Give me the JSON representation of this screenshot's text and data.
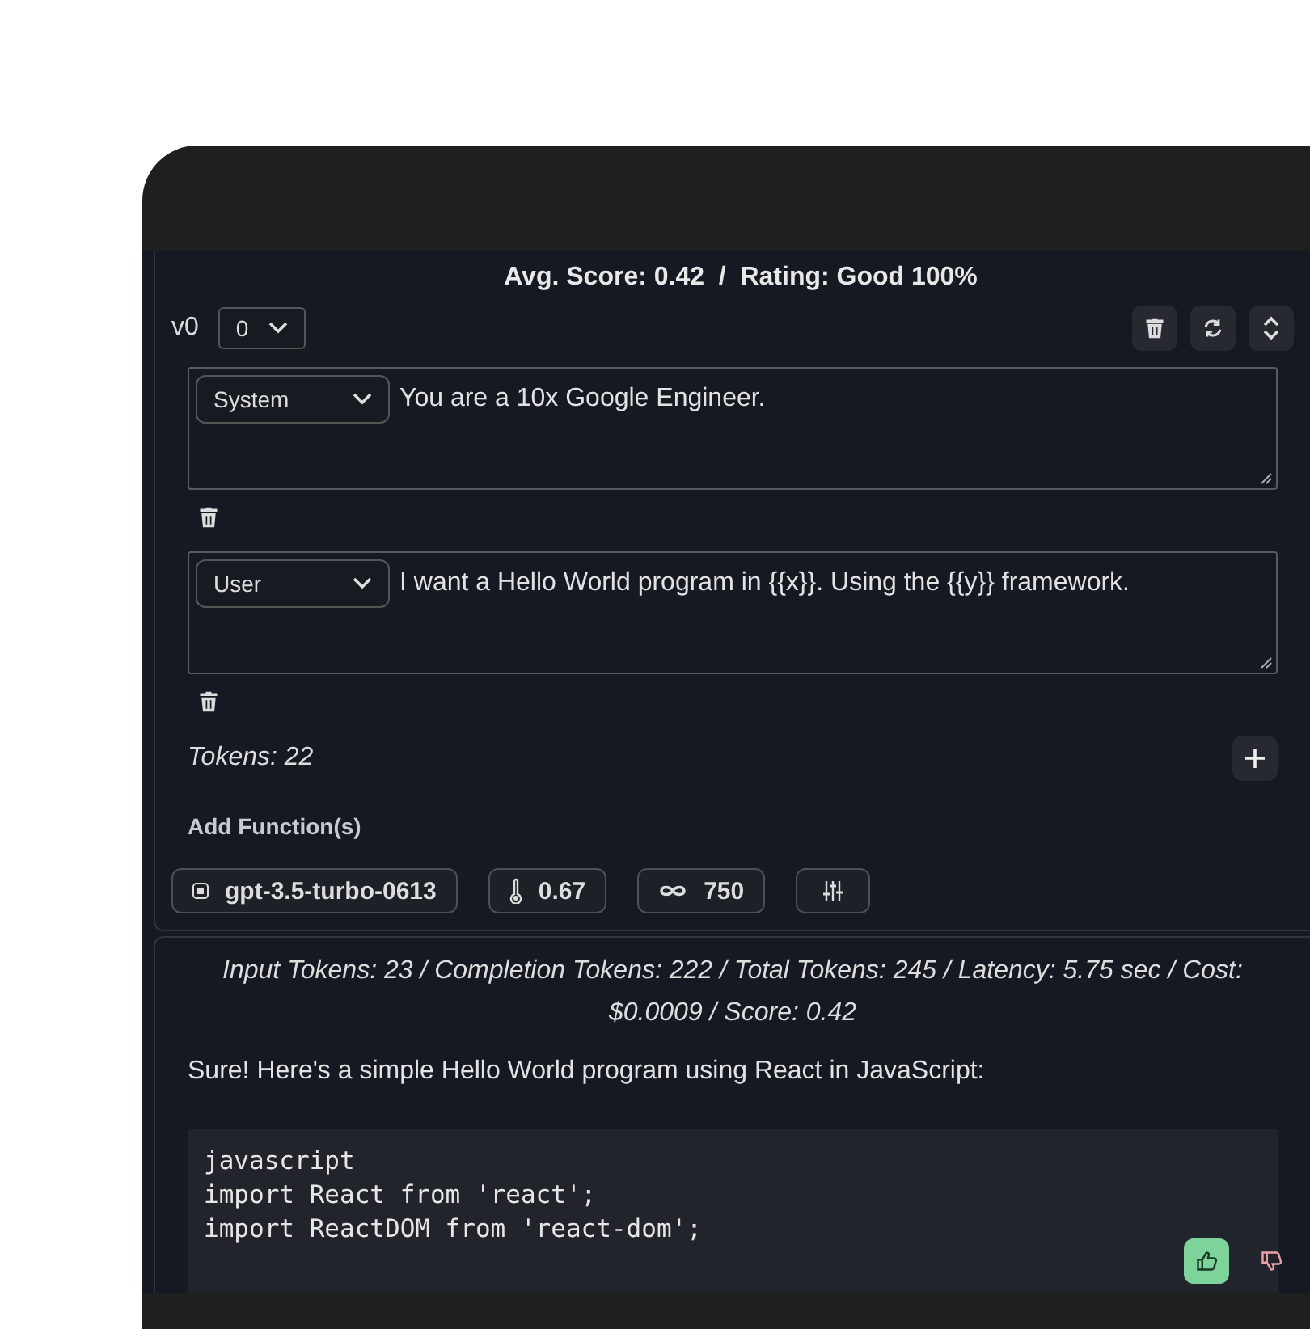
{
  "summary": "Avg. Score: 0.42  /  Rating: Good 100%",
  "version": {
    "label": "v0",
    "value": "0"
  },
  "toolbar": [
    {
      "kind": "delete"
    },
    {
      "kind": "refresh"
    },
    {
      "kind": "collapse"
    }
  ],
  "messages": [
    {
      "role": "System",
      "content": "You are a 10x Google Engineer."
    },
    {
      "role": "User",
      "content": "I want a Hello World program in {{x}}. Using the {{y}} framework."
    }
  ],
  "tokens": "Tokens: 22",
  "add_functions": "Add Function(s)",
  "settings": [
    {
      "kind": "model",
      "value": "gpt-3.5-turbo-0613"
    },
    {
      "kind": "temperature",
      "value": "0.67"
    },
    {
      "kind": "max_tokens",
      "value": "750"
    },
    {
      "kind": "advanced"
    }
  ],
  "result": {
    "stats": "Input Tokens: 23 / Completion Tokens: 222 / Total Tokens: 245 / Latency: 5.75 sec / Cost: $0.0009 / Score: 0.42",
    "text": "Sure! Here's a simple Hello World program using React in JavaScript:",
    "code": [
      "javascript",
      "import React from 'react';",
      "import ReactDOM from 'react-dom';"
    ],
    "feedback": [
      {
        "kind": "up",
        "selected": true
      },
      {
        "kind": "down",
        "selected": false
      }
    ]
  }
}
